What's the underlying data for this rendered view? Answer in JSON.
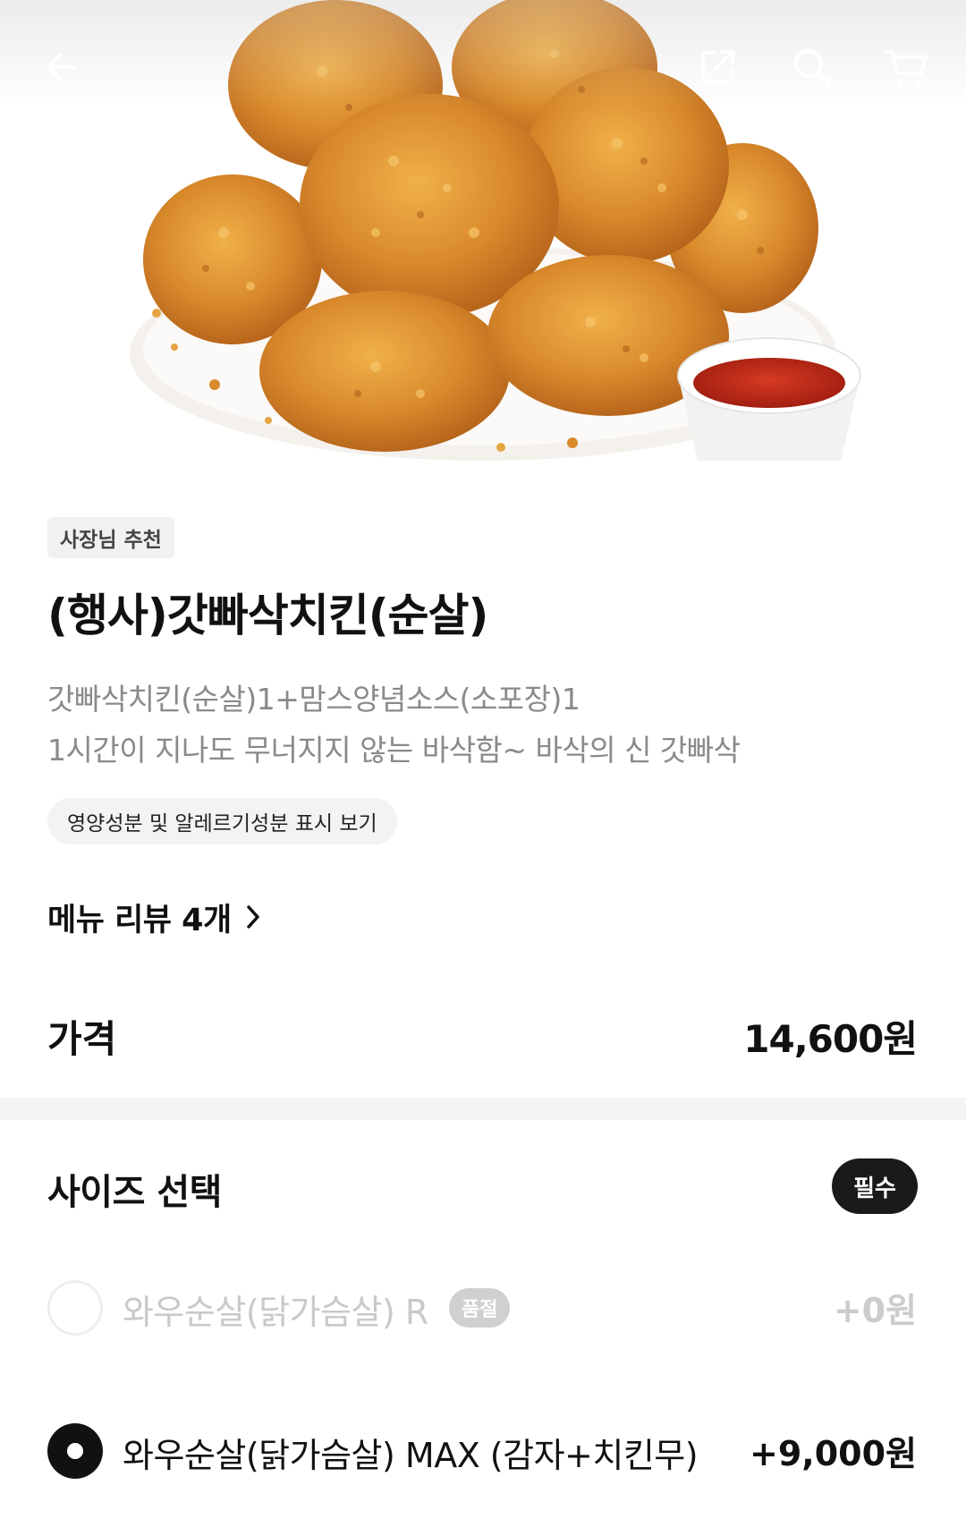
{
  "header": {
    "back_icon": "arrow-left-icon",
    "share_icon": "share-icon",
    "search_icon": "search-icon",
    "cart_icon": "cart-icon"
  },
  "hero": {
    "image": "fried-chicken-photo"
  },
  "product": {
    "badge": "사장님 추천",
    "title": "(행사)갓빠삭치킨(순살)",
    "description_line1": "갓빠삭치킨(순살)1+맘스양념소스(소포장)1",
    "description_line2": "1시간이 지나도 무너지지 않는 바삭함~ 바삭의 신 갓빠삭",
    "nutrition_button": "영양성분 및 알레르기성분 표시 보기",
    "review_link": "메뉴 리뷰 4개",
    "price_label": "가격",
    "price_value": "14,600원"
  },
  "size_section": {
    "title": "사이즈 선택",
    "required_badge": "필수",
    "options": [
      {
        "label": "와우순살(닭가슴살) R",
        "status": "품절",
        "price": "+0원",
        "selected": false,
        "disabled": true
      },
      {
        "label": "와우순살(닭가슴살) MAX (감자+치킨무)",
        "price": "+9,000원",
        "selected": true,
        "disabled": false
      }
    ]
  },
  "colors": {
    "text_primary": "#111111",
    "text_secondary": "#8a8a8a",
    "disabled_text": "#c9c9c9",
    "badge_bg": "#f1f1f1",
    "required_bg": "#1a1a1a"
  }
}
